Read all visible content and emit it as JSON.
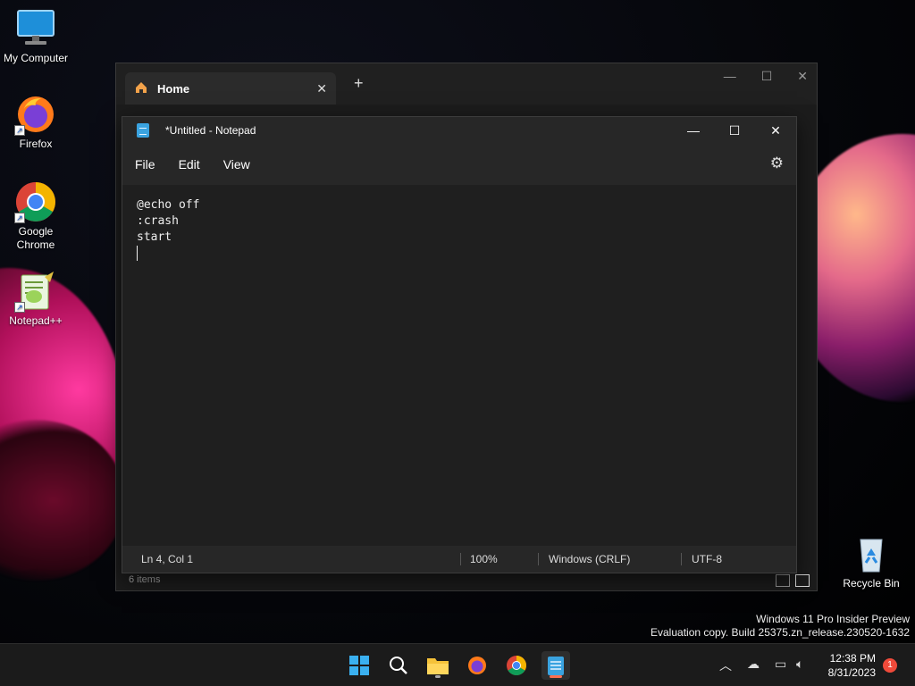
{
  "desktop": {
    "icons": [
      {
        "label": "My Computer"
      },
      {
        "label": "Firefox"
      },
      {
        "label": "Google Chrome"
      },
      {
        "label": "Notepad++"
      },
      {
        "label": "Recycle Bin"
      }
    ]
  },
  "explorer": {
    "tab_label": "Home",
    "add_tab": "+",
    "status": "6 items"
  },
  "notepad": {
    "title": "*Untitled - Notepad",
    "menu": [
      "File",
      "Edit",
      "View"
    ],
    "lines": [
      "@echo off",
      ":crash",
      "start"
    ],
    "status": {
      "position": "Ln 4, Col 1",
      "zoom": "100%",
      "line_ending": "Windows (CRLF)",
      "encoding": "UTF-8"
    }
  },
  "watermark": {
    "line1": "Windows 11 Pro Insider Preview",
    "line2": "Evaluation copy. Build 25375.zn_release.230520-1632"
  },
  "taskbar": {
    "time": "12:38 PM",
    "date": "8/31/2023",
    "notification_count": "1"
  },
  "colors": {
    "accent": "#3aa3e0",
    "notification": "#f04a3a",
    "active_indicator": "#ff6f50"
  }
}
